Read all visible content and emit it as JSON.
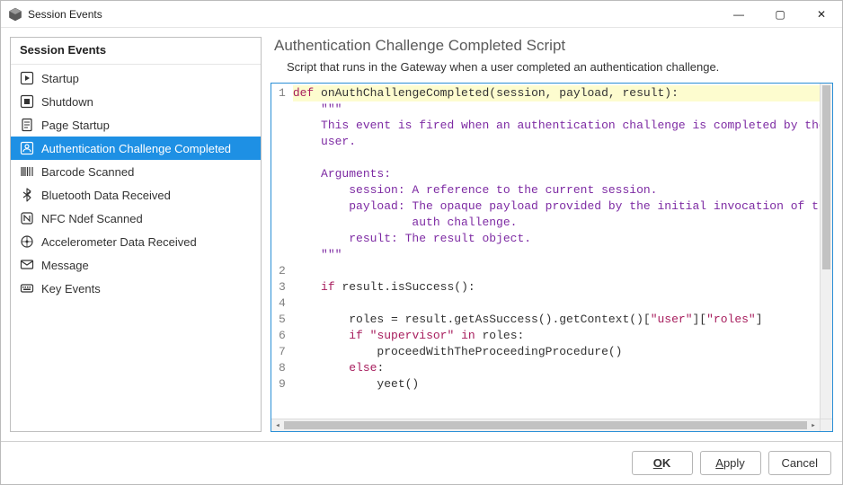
{
  "window": {
    "title": "Session Events",
    "controls": {
      "min": "—",
      "max": "▢",
      "close": "✕"
    }
  },
  "sidebar": {
    "header": "Session Events",
    "selected_index": 3,
    "items": [
      {
        "label": "Startup",
        "icon": "play"
      },
      {
        "label": "Shutdown",
        "icon": "stop"
      },
      {
        "label": "Page Startup",
        "icon": "page"
      },
      {
        "label": "Authentication Challenge Completed",
        "icon": "auth"
      },
      {
        "label": "Barcode Scanned",
        "icon": "barcode"
      },
      {
        "label": "Bluetooth Data Received",
        "icon": "bluetooth"
      },
      {
        "label": "NFC Ndef Scanned",
        "icon": "nfc"
      },
      {
        "label": "Accelerometer Data Received",
        "icon": "accel"
      },
      {
        "label": "Message",
        "icon": "message"
      },
      {
        "label": "Key Events",
        "icon": "key"
      }
    ]
  },
  "main": {
    "title": "Authentication Challenge Completed Script",
    "description": "Script that runs in the Gateway when a user completed an authentication challenge."
  },
  "code": {
    "gutter": [
      "1",
      "",
      "",
      "",
      "",
      "",
      "",
      "",
      "",
      "",
      "",
      "2",
      "3",
      "4",
      "5",
      "6",
      "7",
      "8",
      "9"
    ],
    "lines": [
      {
        "hl": true,
        "segs": [
          {
            "cls": "tok-def",
            "t": "def "
          },
          {
            "cls": "tok-fn",
            "t": "onAuthChallengeCompleted(session, payload, result):"
          }
        ]
      },
      {
        "segs": [
          {
            "cls": "tok-str",
            "t": "    \"\"\""
          }
        ]
      },
      {
        "segs": [
          {
            "cls": "tok-str",
            "t": "    This event is fired when an authentication challenge is completed by the"
          }
        ]
      },
      {
        "segs": [
          {
            "cls": "tok-str",
            "t": "    user."
          }
        ]
      },
      {
        "segs": [
          {
            "cls": "tok-str",
            "t": ""
          }
        ]
      },
      {
        "segs": [
          {
            "cls": "tok-str",
            "t": "    Arguments:"
          }
        ]
      },
      {
        "segs": [
          {
            "cls": "tok-str",
            "t": "        session: A reference to the current session."
          }
        ]
      },
      {
        "segs": [
          {
            "cls": "tok-str",
            "t": "        payload: The opaque payload provided by the initial invocation of the"
          }
        ]
      },
      {
        "segs": [
          {
            "cls": "tok-str",
            "t": "                 auth challenge."
          }
        ]
      },
      {
        "segs": [
          {
            "cls": "tok-str",
            "t": "        result: The result object."
          }
        ]
      },
      {
        "segs": [
          {
            "cls": "tok-str",
            "t": "    \"\"\""
          }
        ]
      },
      {
        "segs": [
          {
            "cls": "",
            "t": ""
          }
        ]
      },
      {
        "segs": [
          {
            "cls": "",
            "t": "    "
          },
          {
            "cls": "tok-kw",
            "t": "if"
          },
          {
            "cls": "",
            "t": " result.isSuccess():"
          }
        ]
      },
      {
        "segs": [
          {
            "cls": "",
            "t": ""
          }
        ]
      },
      {
        "segs": [
          {
            "cls": "",
            "t": "        roles = result.getAsSuccess().getContext()["
          },
          {
            "cls": "tok-lit",
            "t": "\"user\""
          },
          {
            "cls": "",
            "t": "]["
          },
          {
            "cls": "tok-lit",
            "t": "\"roles\""
          },
          {
            "cls": "",
            "t": "]"
          }
        ]
      },
      {
        "segs": [
          {
            "cls": "",
            "t": "        "
          },
          {
            "cls": "tok-kw",
            "t": "if"
          },
          {
            "cls": "",
            "t": " "
          },
          {
            "cls": "tok-lit",
            "t": "\"supervisor\""
          },
          {
            "cls": "",
            "t": " "
          },
          {
            "cls": "tok-kw",
            "t": "in"
          },
          {
            "cls": "",
            "t": " roles:"
          }
        ]
      },
      {
        "segs": [
          {
            "cls": "",
            "t": "            proceedWithTheProceedingProcedure()"
          }
        ]
      },
      {
        "segs": [
          {
            "cls": "",
            "t": "        "
          },
          {
            "cls": "tok-kw",
            "t": "else"
          },
          {
            "cls": "",
            "t": ":"
          }
        ]
      },
      {
        "segs": [
          {
            "cls": "",
            "t": "            yeet()"
          }
        ]
      }
    ]
  },
  "footer": {
    "ok": "OK",
    "apply": "Apply",
    "cancel": "Cancel"
  }
}
